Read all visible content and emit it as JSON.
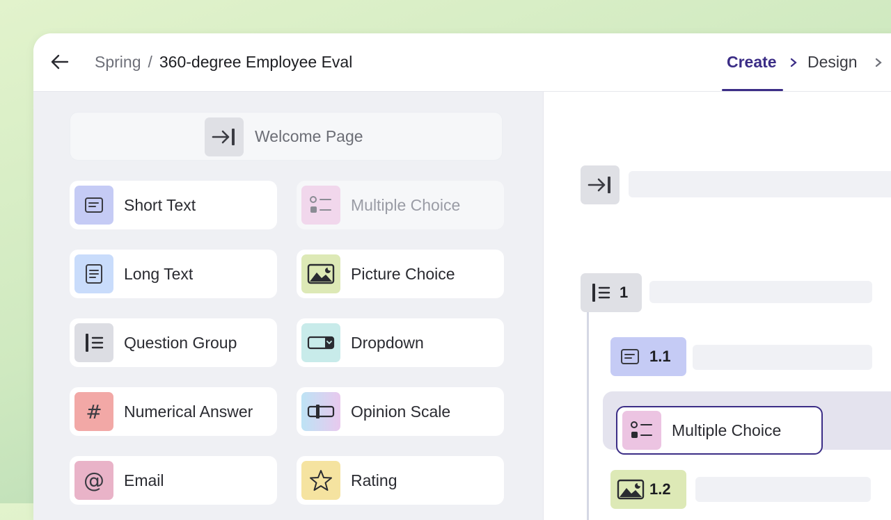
{
  "header": {
    "back_icon": "arrow-left-icon",
    "breadcrumb": {
      "workspace": "Spring",
      "separator": "/",
      "title": "360-degree Employee Eval"
    },
    "steps": [
      {
        "label": "Create",
        "active": true
      },
      {
        "label": "Design",
        "active": false
      }
    ]
  },
  "palette": {
    "welcome": {
      "label": "Welcome Page",
      "icon": "enter-arrow-icon"
    },
    "items": [
      {
        "label": "Short Text",
        "icon": "short-text-icon",
        "color": "#c5cbf5",
        "disabled": false
      },
      {
        "label": "Multiple Choice",
        "icon": "multiple-choice-icon",
        "color": "#f1d7ec",
        "disabled": true
      },
      {
        "label": "Long Text",
        "icon": "long-text-icon",
        "color": "#c9dcfb",
        "disabled": false
      },
      {
        "label": "Picture Choice",
        "icon": "picture-icon",
        "color": "#dde9b6",
        "disabled": false
      },
      {
        "label": "Question Group",
        "icon": "question-group-icon",
        "color": "#dcdde3",
        "disabled": false
      },
      {
        "label": "Dropdown",
        "icon": "dropdown-icon",
        "color": "#c8ebea",
        "disabled": false
      },
      {
        "label": "Numerical Answer",
        "icon": "hash-icon",
        "color": "#f2a8a6",
        "disabled": false
      },
      {
        "label": "Opinion Scale",
        "icon": "opinion-scale-icon",
        "color": "gradient",
        "disabled": false
      },
      {
        "label": "Email",
        "icon": "at-icon",
        "color": "#e9b3c8",
        "disabled": false
      },
      {
        "label": "Rating",
        "icon": "star-icon",
        "color": "#f5e3a0",
        "disabled": false
      }
    ]
  },
  "canvas": {
    "group_number": "1",
    "question_1_1": "1.1",
    "dragging_label": "Multiple Choice",
    "question_1_2": "1.2"
  },
  "colors": {
    "accent": "#3b2d86"
  }
}
